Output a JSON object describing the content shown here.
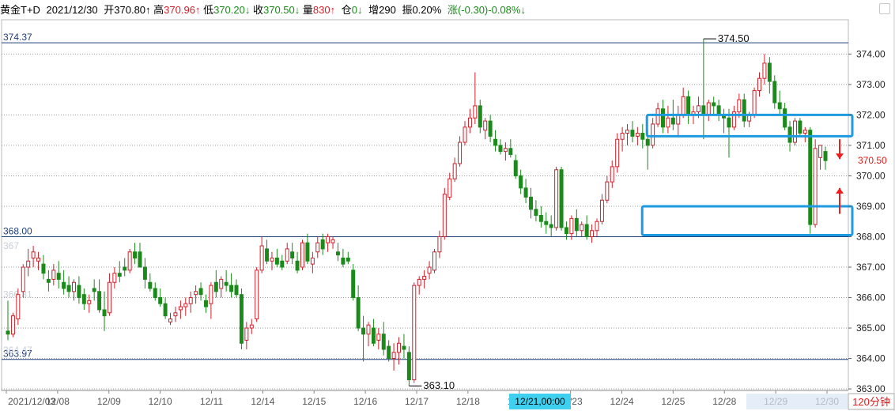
{
  "info_bar": {
    "name": "黄金T+D",
    "date": "2021/12/30",
    "open_label": "开",
    "open_value": "370.80↑",
    "high_label": "高",
    "high_value": "370.96↑",
    "low_label": "低",
    "low_value": "370.20↓",
    "close_label": "收",
    "close_value": "370.50↓",
    "vol_label": "量",
    "vol_value": "830↑",
    "oi_label": "仓",
    "oi_value": "0↓",
    "inc_label": "增",
    "inc_value": "290",
    "amp_label": "振",
    "amp_value": "0.20%",
    "chg_label": "涨",
    "chg_value": "(-0.30)-0.08%↓"
  },
  "colors": {
    "up": "#d0202a",
    "down": "#1b8a1b",
    "hline": "#1f3f7a",
    "box": "#1e9be0",
    "arrow": "#ee1c1c",
    "cursor_bg": "#3fd0f0",
    "period_bg": "#ffffff"
  },
  "chart_data": {
    "type": "candlestick",
    "period": "120分钟",
    "ylim": [
      362.95,
      375.1
    ],
    "y_ticks": [
      "363.00",
      "364.00",
      "365.00",
      "366.00",
      "367.00",
      "368.00",
      "369.00",
      "370.00",
      "371.00",
      "372.00",
      "373.00",
      "374.00"
    ],
    "last_price": "370.50",
    "x_labels": [
      "2021/12/03",
      "12/08",
      "12/09",
      "12/10",
      "12/11",
      "12/14",
      "12/15",
      "12/16",
      "12/17",
      "12/18",
      "12/22",
      "12/23",
      "12/24",
      "12/25",
      "12/28",
      "12/29",
      "12/30"
    ],
    "cursor_label": "12/21,00:00",
    "horizontal_lines": [
      {
        "value": 374.37,
        "label": "374.37"
      },
      {
        "value": 368.0,
        "label": "368.00"
      },
      {
        "value": 363.97,
        "label": "363.97"
      }
    ],
    "faded_labels": [
      {
        "value": 367.7,
        "label": "367"
      },
      {
        "value": 366.1,
        "label": "366.31"
      },
      {
        "value": 364.28,
        "label": "364.47"
      }
    ],
    "annotations": [
      {
        "value": 374.5,
        "label": "374.50"
      },
      {
        "value": 363.1,
        "label": "363.10"
      }
    ],
    "boxes": [
      {
        "top": 372.0,
        "bottom": 371.3
      },
      {
        "top": 369.0,
        "bottom": 368.05
      }
    ],
    "candles": [
      [
        364.9,
        365.9,
        364.6,
        364.8
      ],
      [
        364.8,
        365.5,
        364.7,
        365.4
      ],
      [
        365.3,
        366.3,
        365.1,
        366.1
      ],
      [
        366.2,
        367.1,
        366.0,
        367.0
      ],
      [
        367.0,
        367.6,
        366.7,
        367.2
      ],
      [
        367.3,
        367.7,
        367.0,
        367.5
      ],
      [
        367.2,
        367.5,
        366.9,
        367.3
      ],
      [
        367.1,
        367.4,
        366.6,
        366.8
      ],
      [
        366.6,
        366.9,
        366.2,
        366.5
      ],
      [
        366.6,
        367.1,
        366.4,
        366.9
      ],
      [
        366.8,
        367.2,
        366.3,
        366.6
      ],
      [
        366.5,
        366.9,
        366.1,
        366.3
      ],
      [
        366.4,
        366.7,
        366.0,
        366.2
      ],
      [
        366.2,
        366.6,
        365.9,
        366.5
      ],
      [
        366.4,
        366.7,
        365.8,
        366.0
      ],
      [
        366.1,
        366.3,
        365.6,
        365.8
      ],
      [
        365.8,
        366.1,
        365.5,
        365.9
      ],
      [
        366.3,
        366.6,
        365.9,
        366.2
      ],
      [
        366.2,
        366.6,
        365.5,
        365.6
      ],
      [
        365.6,
        366.2,
        364.9,
        365.4
      ],
      [
        365.5,
        366.8,
        365.4,
        366.5
      ],
      [
        366.5,
        367.0,
        366.3,
        366.8
      ],
      [
        366.8,
        367.2,
        366.5,
        366.7
      ],
      [
        367.0,
        367.3,
        366.7,
        366.9
      ],
      [
        366.9,
        367.6,
        366.8,
        367.5
      ],
      [
        367.5,
        367.8,
        367.1,
        367.3
      ],
      [
        367.5,
        367.8,
        367.0,
        367.0
      ],
      [
        367.0,
        367.3,
        366.3,
        366.6
      ],
      [
        366.5,
        366.8,
        366.2,
        366.3
      ],
      [
        366.3,
        366.5,
        365.9,
        366.0
      ],
      [
        366.0,
        366.3,
        365.7,
        365.8
      ],
      [
        365.8,
        366.0,
        365.3,
        365.4
      ],
      [
        365.2,
        365.5,
        365.1,
        365.3
      ],
      [
        365.4,
        365.7,
        365.2,
        365.5
      ],
      [
        365.6,
        365.9,
        365.3,
        365.7
      ],
      [
        365.7,
        366.0,
        365.4,
        365.8
      ],
      [
        365.8,
        366.2,
        365.5,
        366.0
      ],
      [
        366.1,
        366.4,
        365.8,
        366.2
      ],
      [
        366.3,
        366.5,
        365.9,
        366.1
      ],
      [
        365.9,
        366.1,
        365.5,
        365.7
      ],
      [
        365.8,
        366.5,
        365.3,
        366.4
      ],
      [
        366.5,
        366.9,
        366.0,
        366.2
      ],
      [
        366.3,
        366.7,
        366.0,
        366.6
      ],
      [
        366.5,
        366.9,
        366.2,
        366.4
      ],
      [
        366.4,
        366.8,
        366.0,
        366.2
      ],
      [
        366.4,
        366.6,
        366.0,
        366.1
      ],
      [
        366.1,
        366.3,
        364.3,
        364.5
      ],
      [
        364.6,
        365.2,
        364.3,
        365.0
      ],
      [
        365.0,
        365.3,
        364.8,
        365.1
      ],
      [
        365.3,
        367.0,
        365.2,
        366.9
      ],
      [
        366.9,
        368.0,
        366.8,
        367.7
      ],
      [
        367.6,
        367.9,
        367.1,
        367.2
      ],
      [
        367.2,
        367.5,
        366.9,
        367.3
      ],
      [
        367.3,
        367.6,
        367.0,
        367.1
      ],
      [
        367.2,
        367.4,
        366.9,
        367.0
      ],
      [
        367.2,
        367.8,
        367.1,
        367.6
      ],
      [
        367.5,
        367.8,
        367.1,
        367.3
      ],
      [
        367.2,
        367.5,
        366.8,
        366.9
      ],
      [
        367.0,
        367.9,
        366.9,
        367.8
      ],
      [
        367.8,
        368.1,
        367.1,
        367.2
      ],
      [
        367.1,
        367.5,
        366.8,
        367.3
      ],
      [
        367.5,
        368.0,
        367.3,
        367.8
      ],
      [
        367.9,
        368.1,
        367.4,
        367.6
      ],
      [
        367.8,
        368.1,
        367.5,
        368.0
      ],
      [
        367.8,
        368.0,
        367.6,
        367.9
      ],
      [
        367.5,
        367.8,
        367.2,
        367.4
      ],
      [
        367.3,
        367.6,
        367.0,
        367.1
      ],
      [
        367.3,
        367.5,
        367.1,
        367.2
      ],
      [
        366.9,
        367.1,
        365.9,
        366.0
      ],
      [
        366.0,
        366.4,
        364.9,
        365.0
      ],
      [
        365.0,
        365.4,
        363.9,
        364.8
      ],
      [
        364.8,
        365.2,
        364.4,
        365.1
      ],
      [
        365.0,
        365.3,
        364.4,
        364.5
      ],
      [
        364.6,
        365.0,
        364.3,
        364.8
      ],
      [
        364.8,
        365.2,
        364.1,
        364.3
      ],
      [
        364.4,
        364.6,
        363.9,
        364.0
      ],
      [
        364.0,
        364.5,
        363.6,
        364.2
      ],
      [
        364.2,
        364.7,
        363.8,
        364.5
      ],
      [
        364.4,
        364.8,
        364.0,
        364.3
      ],
      [
        364.2,
        364.4,
        363.1,
        363.3
      ],
      [
        363.3,
        366.5,
        363.2,
        366.4
      ],
      [
        366.4,
        366.7,
        366.1,
        366.6
      ],
      [
        366.6,
        366.9,
        366.3,
        366.7
      ],
      [
        366.8,
        367.2,
        366.6,
        367.0
      ],
      [
        366.9,
        367.6,
        366.8,
        367.5
      ],
      [
        367.5,
        368.2,
        367.3,
        368.0
      ],
      [
        368.0,
        369.6,
        367.9,
        369.4
      ],
      [
        369.3,
        370.1,
        369.2,
        369.9
      ],
      [
        369.9,
        370.6,
        369.8,
        370.4
      ],
      [
        370.4,
        371.3,
        370.3,
        371.1
      ],
      [
        371.1,
        371.8,
        371.0,
        371.6
      ],
      [
        371.6,
        372.2,
        371.4,
        371.9
      ],
      [
        371.9,
        373.4,
        371.7,
        372.3
      ],
      [
        372.3,
        372.5,
        371.4,
        371.6
      ],
      [
        371.5,
        371.9,
        371.2,
        371.8
      ],
      [
        371.8,
        372.0,
        371.1,
        371.3
      ],
      [
        371.2,
        371.5,
        370.8,
        371.0
      ],
      [
        371.0,
        371.2,
        370.7,
        370.8
      ],
      [
        370.8,
        371.1,
        370.5,
        370.9
      ],
      [
        370.9,
        371.2,
        370.6,
        370.7
      ],
      [
        370.5,
        370.7,
        369.9,
        370.0
      ],
      [
        370.0,
        370.2,
        369.4,
        369.6
      ],
      [
        369.6,
        369.9,
        369.1,
        369.3
      ],
      [
        369.3,
        369.6,
        368.6,
        368.9
      ],
      [
        368.9,
        369.2,
        368.5,
        368.7
      ],
      [
        368.7,
        369.0,
        368.3,
        368.5
      ],
      [
        368.5,
        368.8,
        368.1,
        368.4
      ],
      [
        368.4,
        368.7,
        368.0,
        368.3
      ],
      [
        368.3,
        370.3,
        368.2,
        370.2
      ],
      [
        370.2,
        370.3,
        368.2,
        368.3
      ],
      [
        368.3,
        368.5,
        367.9,
        368.1
      ],
      [
        368.1,
        368.7,
        367.9,
        368.6
      ],
      [
        368.6,
        368.9,
        368.0,
        368.2
      ],
      [
        368.2,
        368.5,
        368.0,
        368.4
      ],
      [
        368.4,
        368.7,
        367.9,
        368.0
      ],
      [
        368.0,
        368.4,
        367.8,
        368.2
      ],
      [
        368.2,
        368.6,
        368.0,
        368.5
      ],
      [
        368.5,
        369.4,
        368.4,
        369.2
      ],
      [
        369.2,
        370.0,
        369.1,
        369.8
      ],
      [
        369.8,
        370.5,
        369.6,
        370.3
      ],
      [
        370.3,
        371.4,
        370.1,
        371.2
      ],
      [
        371.2,
        371.6,
        370.8,
        371.4
      ],
      [
        371.4,
        371.7,
        371.0,
        371.5
      ],
      [
        371.5,
        371.8,
        371.1,
        371.3
      ],
      [
        371.3,
        371.6,
        371.0,
        371.4
      ],
      [
        371.4,
        371.7,
        370.9,
        371.2
      ],
      [
        371.2,
        371.5,
        370.2,
        371.0
      ],
      [
        371.0,
        371.9,
        370.9,
        371.7
      ],
      [
        371.7,
        372.4,
        371.6,
        372.2
      ],
      [
        372.2,
        372.5,
        371.4,
        371.6
      ],
      [
        371.6,
        372.3,
        371.4,
        371.9
      ],
      [
        371.9,
        372.5,
        371.5,
        371.7
      ],
      [
        371.7,
        372.3,
        371.3,
        372.0
      ],
      [
        372.0,
        372.9,
        371.9,
        372.6
      ],
      [
        372.6,
        372.8,
        371.7,
        372.0
      ],
      [
        372.0,
        372.3,
        371.7,
        372.1
      ],
      [
        372.1,
        372.6,
        371.9,
        372.3
      ],
      [
        372.3,
        374.5,
        371.2,
        372.0
      ],
      [
        372.0,
        372.5,
        371.8,
        372.4
      ],
      [
        372.4,
        372.6,
        372.0,
        372.3
      ],
      [
        372.3,
        372.5,
        371.8,
        372.0
      ],
      [
        372.0,
        372.2,
        371.4,
        371.9
      ],
      [
        371.9,
        372.2,
        370.6,
        371.6
      ],
      [
        371.6,
        372.3,
        371.5,
        372.1
      ],
      [
        372.1,
        372.7,
        371.9,
        372.5
      ],
      [
        372.5,
        372.7,
        371.6,
        371.8
      ],
      [
        371.8,
        372.1,
        371.6,
        372.0
      ],
      [
        372.0,
        372.9,
        371.9,
        372.8
      ],
      [
        372.8,
        373.4,
        372.6,
        373.2
      ],
      [
        373.2,
        374.0,
        373.0,
        373.7
      ],
      [
        373.7,
        373.9,
        372.7,
        373.1
      ],
      [
        373.1,
        373.3,
        372.2,
        372.4
      ],
      [
        372.4,
        372.8,
        372.0,
        372.2
      ],
      [
        372.2,
        372.4,
        371.5,
        371.6
      ],
      [
        371.6,
        371.8,
        370.8,
        371.1
      ],
      [
        371.1,
        371.9,
        371.0,
        371.8
      ],
      [
        371.8,
        371.9,
        371.3,
        371.4
      ],
      [
        371.4,
        371.6,
        371.1,
        371.5
      ],
      [
        371.5,
        371.6,
        368.1,
        368.4
      ],
      [
        368.4,
        371.2,
        368.3,
        370.9
      ],
      [
        370.6,
        371.0,
        370.2,
        371.0
      ],
      [
        370.8,
        370.96,
        370.2,
        370.5
      ]
    ]
  }
}
